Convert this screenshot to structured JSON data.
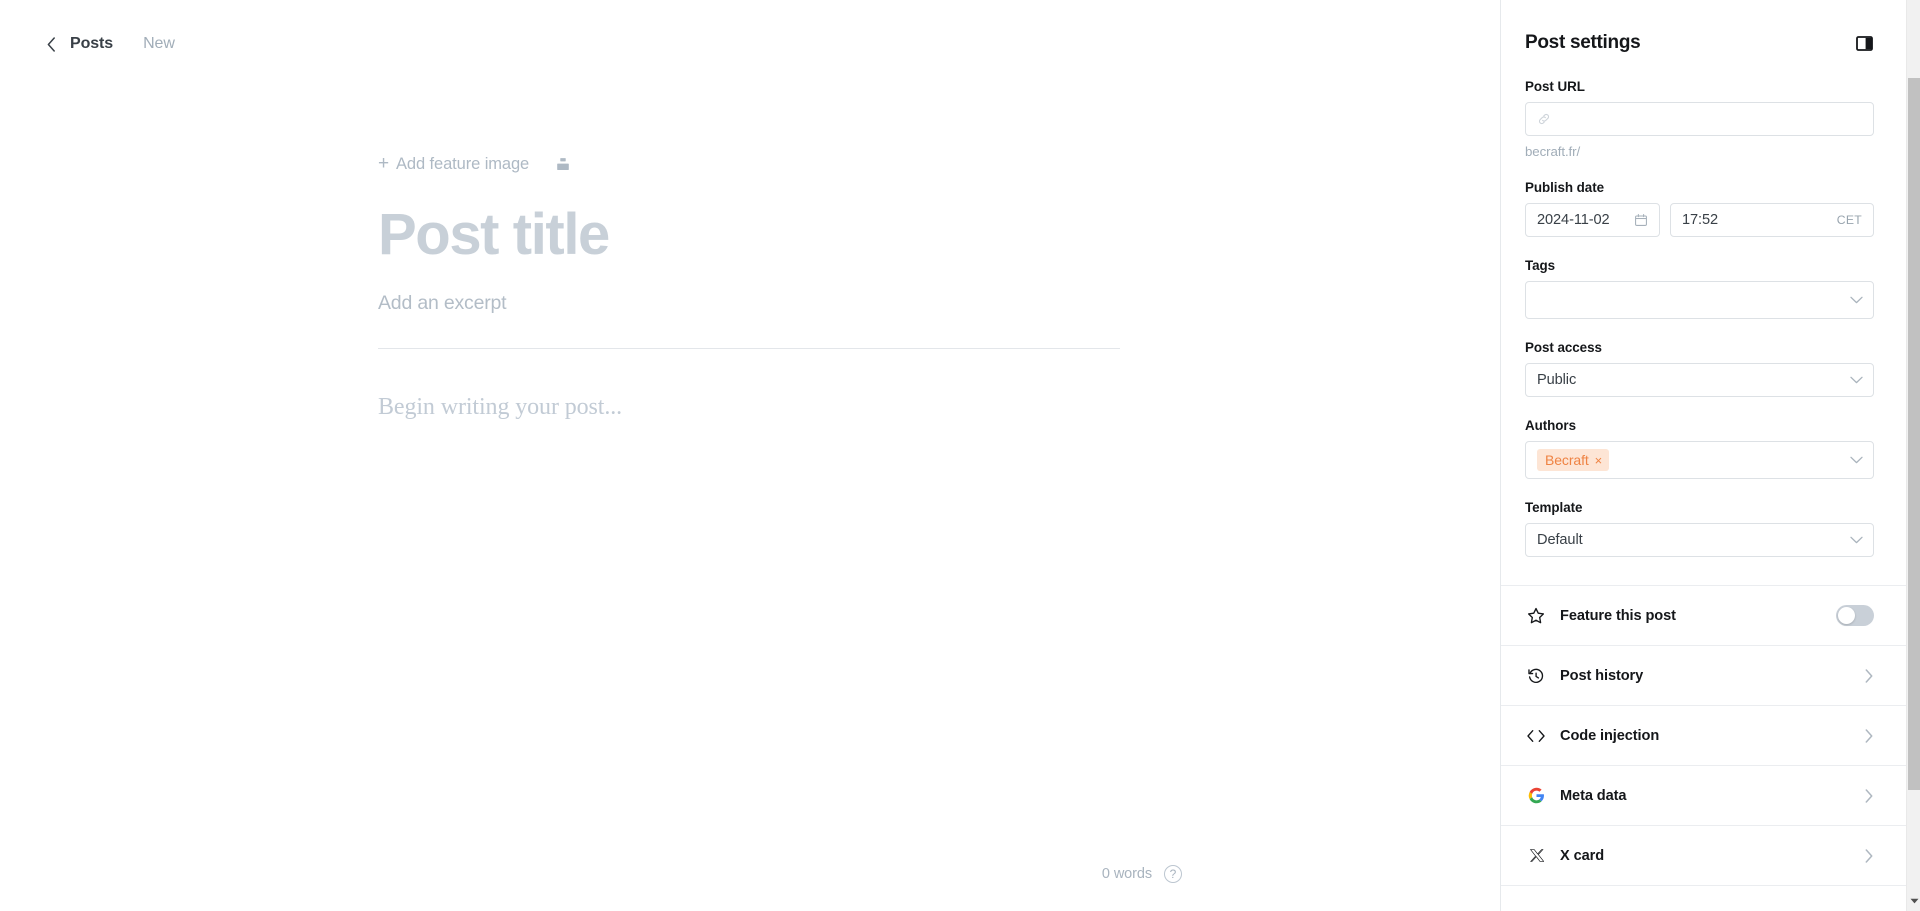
{
  "editor": {
    "breadcrumb": {
      "back_icon": "chevron-left-icon",
      "parent": "Posts",
      "current": "New"
    },
    "feature_image": {
      "plus": "+",
      "label": "Add feature image",
      "unsplash_icon": "unsplash-icon"
    },
    "title_placeholder": "Post title",
    "excerpt_placeholder": "Add an excerpt",
    "body_placeholder": "Begin writing your post...",
    "word_count": "0 words",
    "help_icon_label": "?"
  },
  "sidebar": {
    "title": "Post settings",
    "toggle_icon": "sidebar-toggle-icon",
    "fields": {
      "post_url": {
        "label": "Post URL",
        "value": "",
        "placeholder": "",
        "icon": "link-icon",
        "helper": "becraft.fr/"
      },
      "publish_date": {
        "label": "Publish date",
        "date_value": "2024-11-02",
        "calendar_icon": "calendar-icon",
        "time_value": "17:52",
        "timezone": "CET"
      },
      "tags": {
        "label": "Tags",
        "value": "",
        "chevron_icon": "chevron-down-icon"
      },
      "post_access": {
        "label": "Post access",
        "value": "Public",
        "chevron_icon": "chevron-down-icon"
      },
      "authors": {
        "label": "Authors",
        "chips": [
          {
            "name": "Becraft",
            "remove": "×"
          }
        ],
        "chip_bg": "#fde5d5",
        "chip_fg": "#ef8343",
        "chevron_icon": "chevron-down-icon"
      },
      "template": {
        "label": "Template",
        "value": "Default",
        "chevron_icon": "chevron-down-icon"
      }
    },
    "rows": [
      {
        "icon": "star-icon",
        "label": "Feature this post",
        "control": "toggle",
        "toggle_on": false
      },
      {
        "icon": "history-icon",
        "label": "Post history",
        "control": "chevron"
      },
      {
        "icon": "code-icon",
        "label": "Code injection",
        "control": "chevron"
      },
      {
        "icon": "google-icon",
        "label": "Meta data",
        "control": "chevron"
      },
      {
        "icon": "x-logo-icon",
        "label": "X card",
        "control": "chevron"
      }
    ]
  },
  "colors": {
    "accent_orange": "#ef8343",
    "text_dark": "#15171a",
    "text_muted": "#a1adb8",
    "placeholder_title": "#c8d0d8",
    "border": "#dde1e5",
    "scrollbar_thumb": "#c1c1c1"
  }
}
